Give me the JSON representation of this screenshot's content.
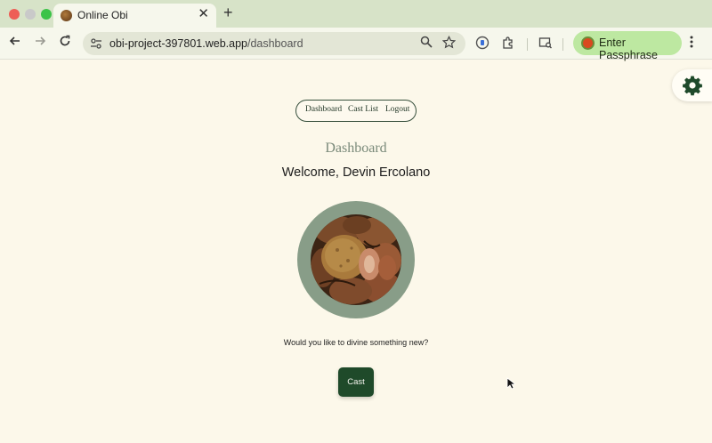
{
  "browser": {
    "tab_title": "Online Obi",
    "tab_close": "✕",
    "new_tab": "+",
    "url_host": "obi-project-397801.web.app",
    "url_path": "/dashboard",
    "extension_button_label": "Enter Passphrase",
    "icons": [
      "back-icon",
      "forward-icon",
      "reload-icon",
      "site-info-icon",
      "zoom-icon",
      "star-icon",
      "extension-ai-icon",
      "puzzle-icon",
      "tab-search-icon",
      "menu-icon"
    ]
  },
  "nav": {
    "links": [
      {
        "label": "Dashboard"
      },
      {
        "label": "Cast List"
      },
      {
        "label": "Logout"
      }
    ]
  },
  "main": {
    "title": "Dashboard",
    "welcome": "Welcome, Devin Ercolano",
    "prompt": "Would you like to divine something new?",
    "cast_label": "Cast"
  },
  "colors": {
    "page_bg": "#fcf8ea",
    "accent_dark_green": "#1f4a2a",
    "circle_sage": "#889d88",
    "chrome_tab_strip": "#d7e3c8",
    "passphrase_pill": "#bde8a1"
  }
}
